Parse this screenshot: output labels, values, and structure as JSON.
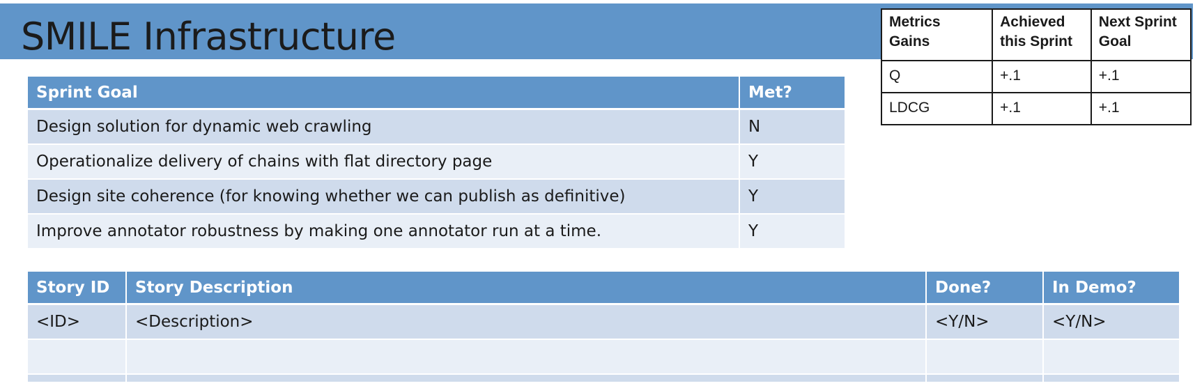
{
  "title": "SMILE Infrastructure",
  "metrics": {
    "headers": [
      "Metrics Gains",
      "Achieved this Sprint",
      "Next Sprint Goal"
    ],
    "rows": [
      [
        "Q",
        "+.1",
        "+.1"
      ],
      [
        "LDCG",
        "+.1",
        "+.1"
      ]
    ]
  },
  "goals": {
    "headers": [
      "Sprint Goal",
      "Met?"
    ],
    "rows": [
      [
        "Design solution for dynamic web crawling",
        "N"
      ],
      [
        "Operationalize delivery of chains with flat directory page",
        "Y"
      ],
      [
        "Design site coherence (for knowing whether we can publish as definitive)",
        "Y"
      ],
      [
        "Improve annotator robustness by making one annotator run at a time.",
        "Y"
      ]
    ]
  },
  "stories": {
    "headers": [
      "Story ID",
      "Story Description",
      "Done?",
      "In Demo?"
    ],
    "rows": [
      [
        "<ID>",
        "<Description>",
        "<Y/N>",
        "<Y/N>"
      ],
      [
        "",
        "",
        "",
        ""
      ],
      [
        "",
        "",
        "",
        ""
      ]
    ]
  },
  "colors": {
    "header_blue": "#6095c9",
    "band_dark": "#cfdbec",
    "band_light": "#e9eff7"
  }
}
